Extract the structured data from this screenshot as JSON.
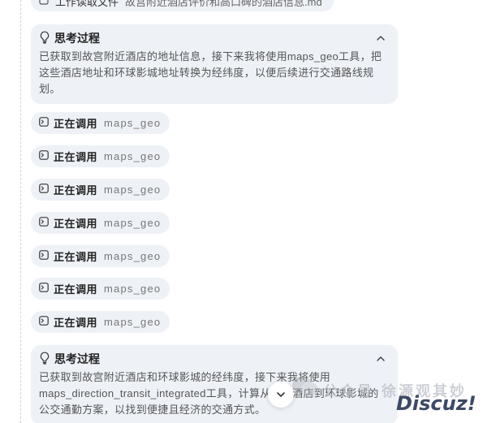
{
  "file_chip": {
    "label": "工作读取文件",
    "filename": "故宫附近酒店评价和高口碑的酒店信息.md"
  },
  "thoughts": [
    {
      "title": "思考过程",
      "body": "已获取到故宫附近酒店的地址信息，接下来我将使用maps_geo工具，把这些酒店地址和环球影城地址转换为经纬度，以便后续进行交通路线规划。"
    },
    {
      "title": "思考过程",
      "body": "已获取到故宫附近酒店和环球影城的经纬度，接下来我将使用maps_direction_transit_integrated工具，计算从这些酒店到环球影城的公交通勤方案，以找到便捷且经济的交通方式。"
    }
  ],
  "tool_calls": [
    {
      "label": "正在调用",
      "tool": "maps_geo"
    },
    {
      "label": "正在调用",
      "tool": "maps_geo"
    },
    {
      "label": "正在调用",
      "tool": "maps_geo"
    },
    {
      "label": "正在调用",
      "tool": "maps_geo"
    },
    {
      "label": "正在调用",
      "tool": "maps_geo"
    },
    {
      "label": "正在调用",
      "tool": "maps_geo"
    },
    {
      "label": "正在调用",
      "tool": "maps_geo"
    }
  ],
  "watermark": {
    "text": "公众号·徐源观其妙",
    "site": "Discuz!"
  },
  "icons": {
    "thought": "lightbulb-icon",
    "collapse": "chevron-up-icon",
    "tool": "terminal-icon",
    "file": "file-icon",
    "scroll": "chevron-down-icon"
  }
}
